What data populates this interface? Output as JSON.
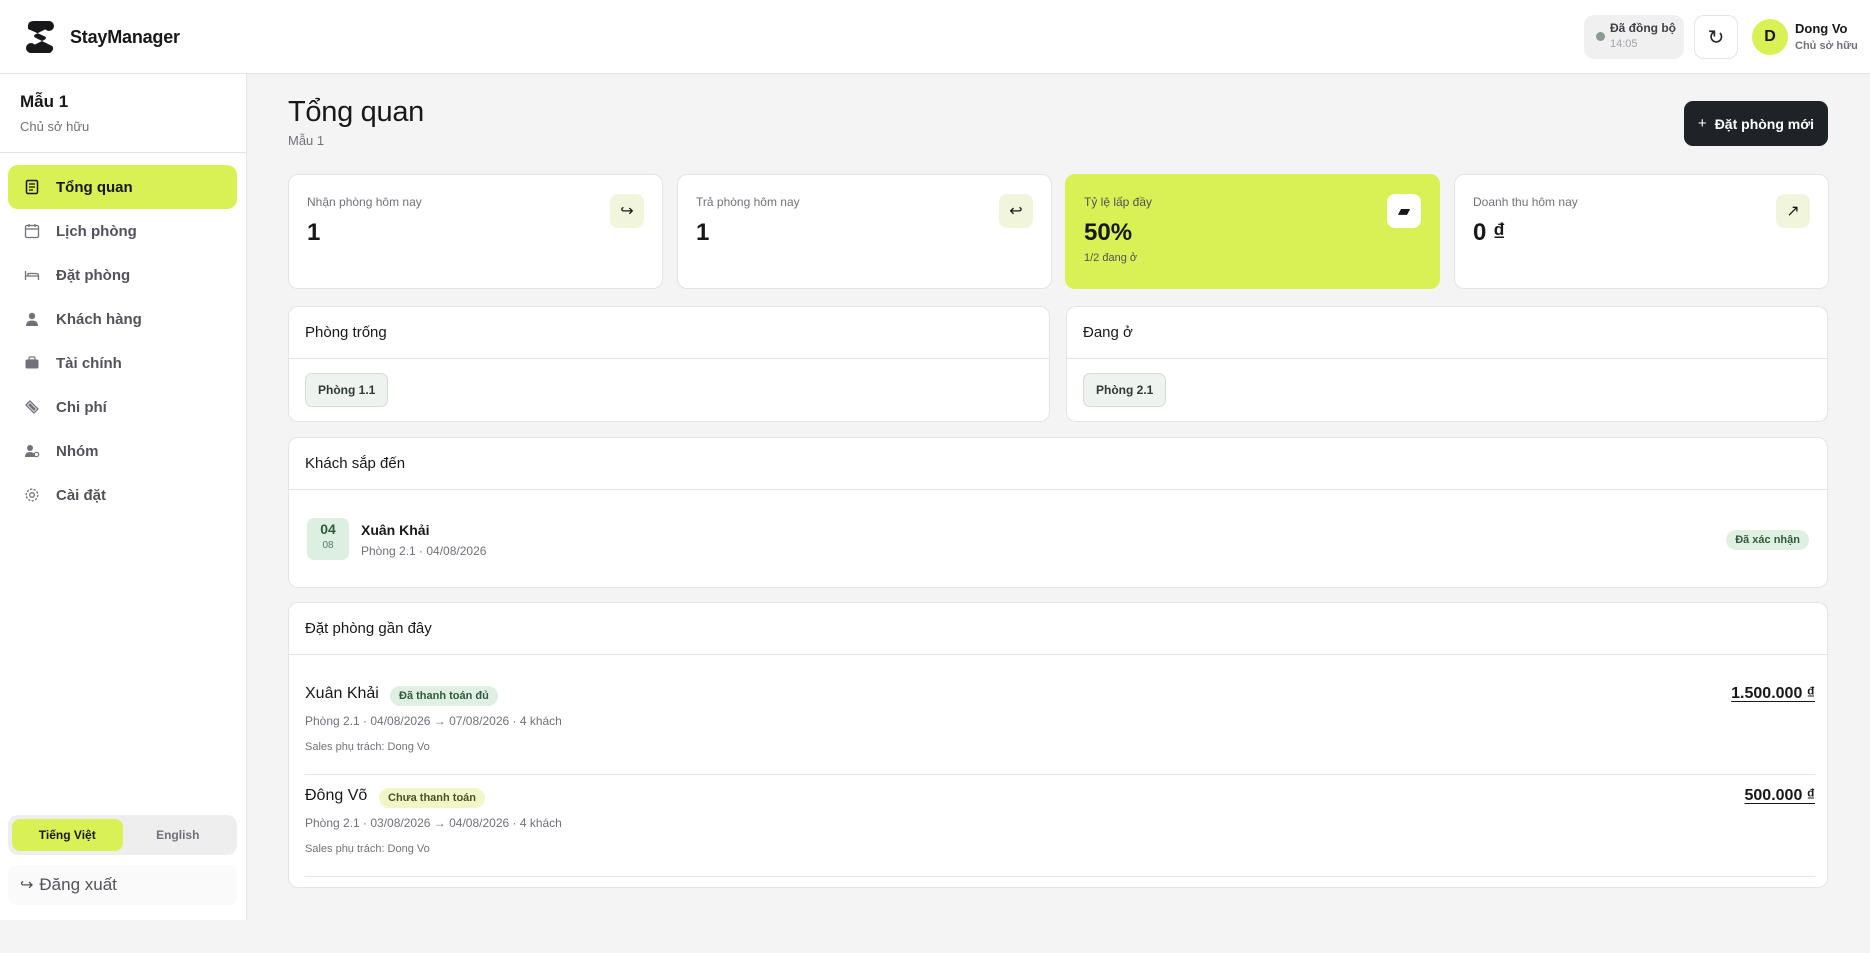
{
  "app": {
    "name": "StayManager"
  },
  "header": {
    "sync_label": "Đã đồng bộ",
    "sync_time": "14:05",
    "refresh_icon": "refresh-icon",
    "user": {
      "initial": "D",
      "name": "Dong Vo",
      "role": "Chủ sở hữu"
    }
  },
  "sidebar": {
    "org_name": "Mẫu 1",
    "org_role": "Chủ sở hữu",
    "items": [
      {
        "label": "Tổng quan",
        "icon": "dashboard-icon",
        "active": true
      },
      {
        "label": "Lịch phòng",
        "icon": "calendar-icon",
        "active": false
      },
      {
        "label": "Đặt phòng",
        "icon": "bed-icon",
        "active": false
      },
      {
        "label": "Khách hàng",
        "icon": "user-icon",
        "active": false
      },
      {
        "label": "Tài chính",
        "icon": "wallet-icon",
        "active": false
      },
      {
        "label": "Chi phí",
        "icon": "tag-icon",
        "active": false
      },
      {
        "label": "Nhóm",
        "icon": "team-icon",
        "active": false
      },
      {
        "label": "Cài đặt",
        "icon": "gear-icon",
        "active": false
      }
    ],
    "languages": [
      {
        "label": "Tiếng Việt",
        "active": true
      },
      {
        "label": "English",
        "active": false
      }
    ],
    "logout_label": "Đăng xuất"
  },
  "page": {
    "title": "Tổng quan",
    "subtitle": "Mẫu 1",
    "new_booking_label": "Đặt phòng mới"
  },
  "stats": [
    {
      "label": "Nhận phòng hôm nay",
      "value": "1",
      "sub": "",
      "icon": "check-in-icon",
      "glyph": "↪"
    },
    {
      "label": "Trả phòng hôm nay",
      "value": "1",
      "sub": "",
      "icon": "check-out-icon",
      "glyph": "↩"
    },
    {
      "label": "Tỷ lệ lấp đầy",
      "value": "50%",
      "sub": "1/2 đang ở",
      "icon": "bed-icon",
      "glyph": "▰"
    },
    {
      "label": "Doanh thu hôm nay",
      "value": "0 ₫",
      "sub": "",
      "icon": "trend-up-icon",
      "glyph": "↗"
    }
  ],
  "vacant": {
    "title": "Phòng trống",
    "rooms": [
      "Phòng 1.1"
    ]
  },
  "occupied": {
    "title": "Đang ở",
    "rooms": [
      "Phòng 2.1"
    ]
  },
  "arrivals": {
    "title": "Khách sắp đến",
    "items": [
      {
        "day": "04",
        "month": "08",
        "name": "Xuân Khải",
        "meta": "Phòng 2.1 · 04/08/2026",
        "status": "Đã xác nhận"
      }
    ]
  },
  "recent": {
    "title": "Đặt phòng gần đây",
    "items": [
      {
        "name": "Xuân Khải",
        "status": "Đã thanh toán đủ",
        "status_color": "green",
        "meta": "Phòng 2.1 · 04/08/2026 → 07/08/2026 · 4 khách",
        "sales": "Sales phụ trách: Dong Vo",
        "amount": "1.500.000 ₫"
      },
      {
        "name": "Đông Võ",
        "status": "Chưa thanh toán",
        "status_color": "yellow",
        "meta": "Phòng 2.1 · 03/08/2026 → 04/08/2026 · 4 khách",
        "sales": "Sales phụ trách: Dong Vo",
        "amount": "500.000 ₫"
      }
    ]
  },
  "colors": {
    "accent": "#d9f154",
    "dark": "#1f2328",
    "muted": "#71717a"
  }
}
